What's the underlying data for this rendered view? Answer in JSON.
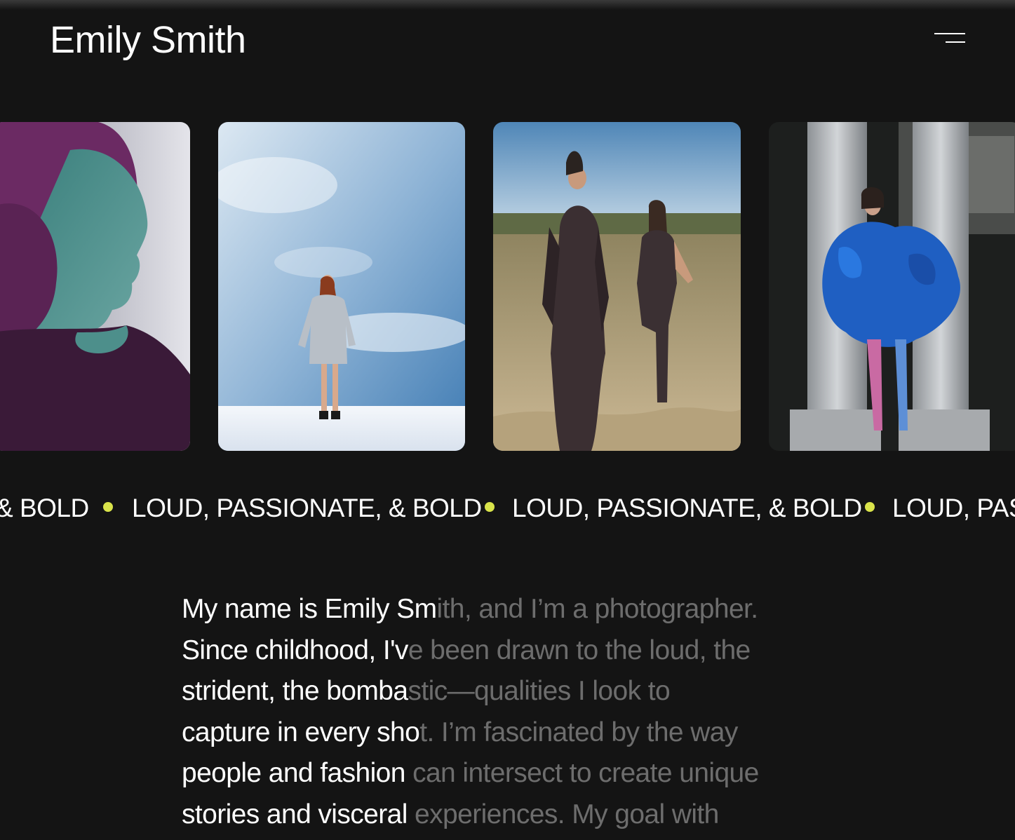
{
  "header": {
    "title": "Emily Smith",
    "menu_icon": "hamburger-menu-icon"
  },
  "gallery": {
    "photos": [
      {
        "name": "photo-portrait-profile",
        "description_icon": "image"
      },
      {
        "name": "photo-snow-sky",
        "description_icon": "image"
      },
      {
        "name": "photo-beach-gowns",
        "description_icon": "image"
      },
      {
        "name": "photo-blue-tulle-columns",
        "description_icon": "image"
      }
    ]
  },
  "ticker": {
    "items": [
      "& BOLD",
      "LOUD, PASSIONATE, & BOLD",
      "LOUD, PASSIONATE, & BOLD",
      "LOUD, PAS"
    ],
    "dot_color": "#d9e34a"
  },
  "bio": {
    "lines": [
      {
        "highlight": "My name is Emily Sm",
        "rest": "ith, and I’m a photographer."
      },
      {
        "highlight": "Since childhood, I'v",
        "rest": "e been drawn to the loud, the"
      },
      {
        "highlight": "strident, the bomba",
        "rest": "stic—qualities I look to"
      },
      {
        "highlight": "capture in every sho",
        "rest": "t. I’m fascinated by the way"
      },
      {
        "highlight": "people and fashion ",
        "rest": "can intersect to create unique"
      },
      {
        "highlight": "stories and visceral ",
        "rest": "experiences. My goal with"
      }
    ],
    "highlight_color": "#ffffff",
    "dim_color": "#6d6d6d"
  }
}
